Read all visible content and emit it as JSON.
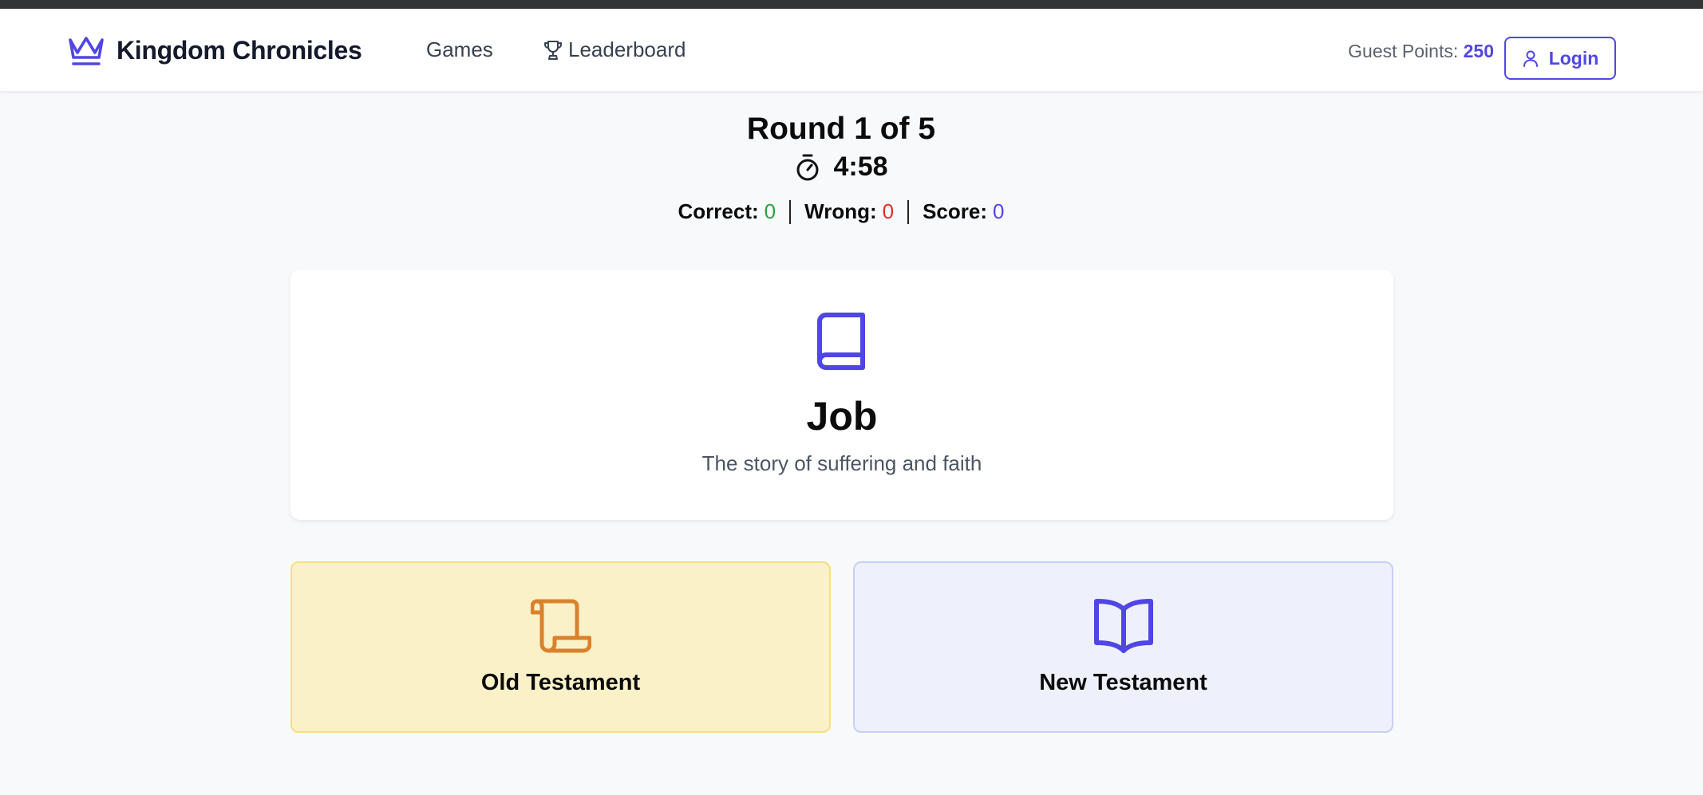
{
  "header": {
    "brand": "Kingdom Chronicles",
    "nav": [
      {
        "label": "Games"
      },
      {
        "label": "Leaderboard",
        "icon": "trophy-icon"
      }
    ],
    "guest_points_label": "Guest Points:",
    "guest_points_value": "250",
    "login_label": "Login"
  },
  "game": {
    "round": "Round 1 of 5",
    "timer": "4:58",
    "stats": {
      "correct_label": "Correct:",
      "correct": "0",
      "wrong_label": "Wrong:",
      "wrong": "0",
      "score_label": "Score:",
      "score": "0"
    },
    "book": {
      "title": "Job",
      "description": "The story of suffering and faith",
      "icon": "book-icon"
    },
    "choices": [
      {
        "label": "Old Testament",
        "icon": "scroll-icon"
      },
      {
        "label": "New Testament",
        "icon": "open-book-icon"
      }
    ]
  },
  "colors": {
    "accent": "#4f46e5",
    "correct": "#2ea043",
    "wrong": "#d93025",
    "old_testament_bg": "#fbf1c9",
    "new_testament_bg": "#eef1fc",
    "scroll_icon": "#d9822b"
  }
}
